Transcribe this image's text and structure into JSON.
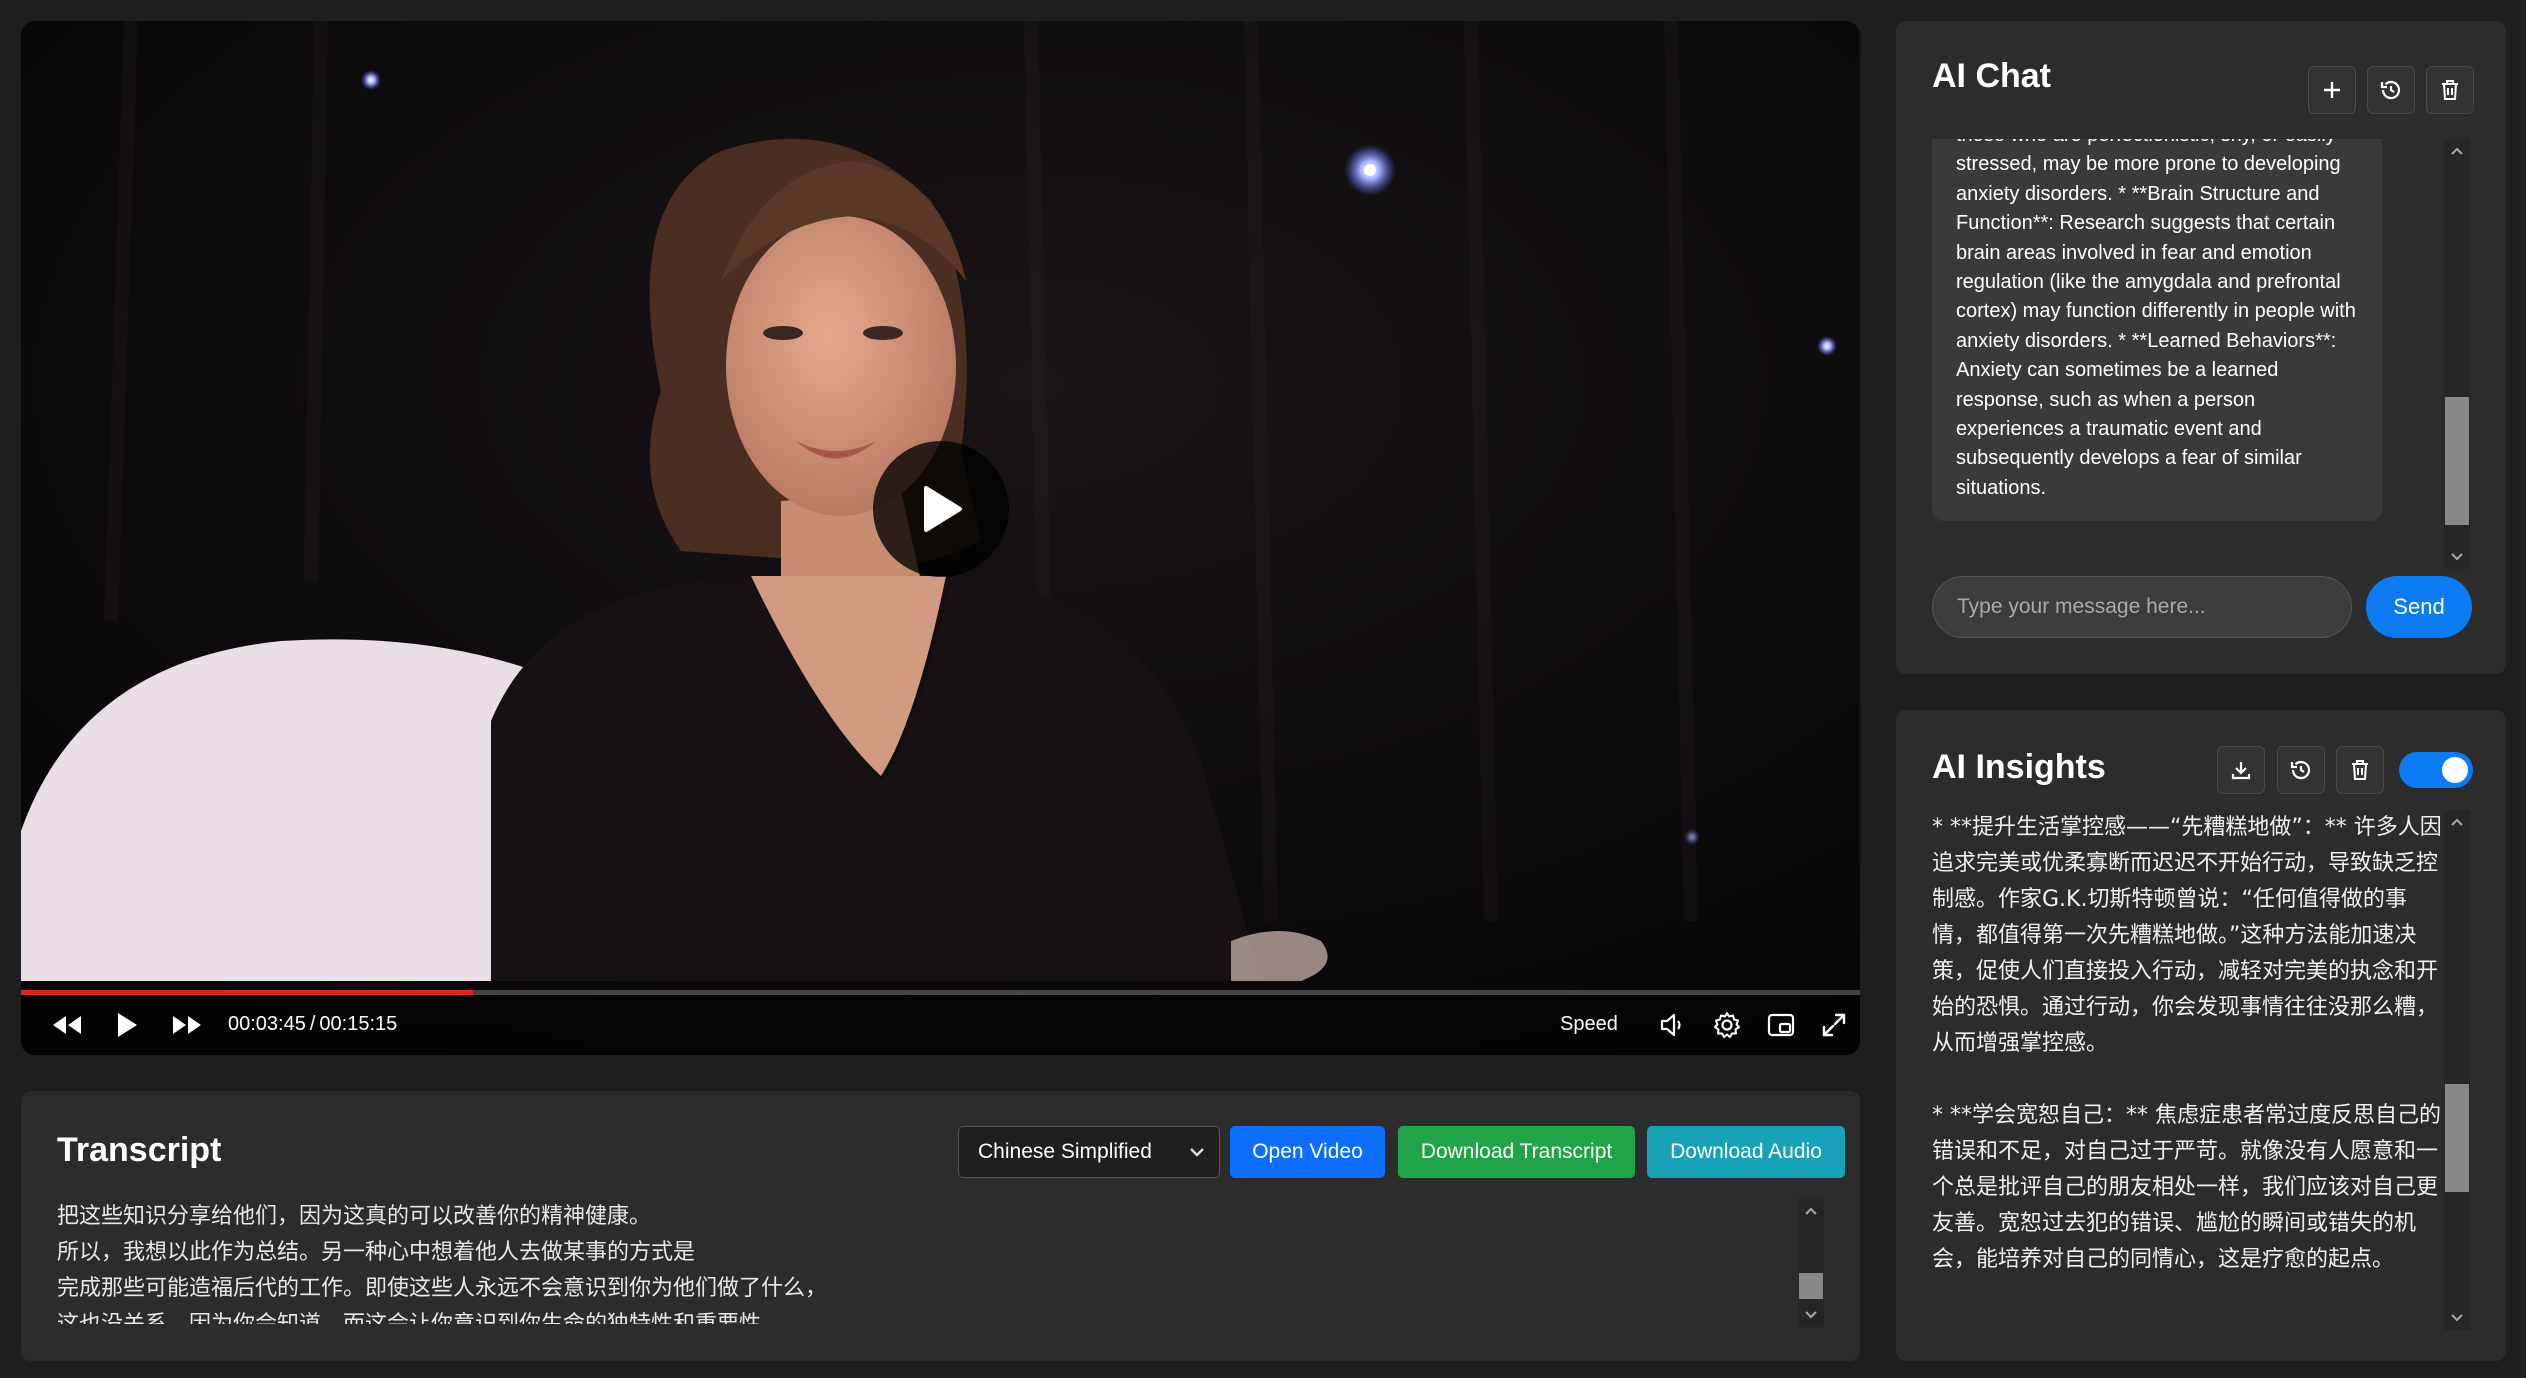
{
  "video": {
    "current_time": "00:03:45",
    "separator": "/",
    "duration": "00:15:15",
    "progress": 0.2459,
    "speed_label": "Speed",
    "progress_color": "#e0241f"
  },
  "transcript": {
    "title": "Transcript",
    "language": "Chinese Simplified",
    "open_video_label": "Open Video",
    "download_transcript_label": "Download Transcript",
    "download_audio_label": "Download Audio",
    "lines": [
      "把这些知识分享给他们，因为这真的可以改善你的精神健康。",
      "所以，我想以此作为总结。另一种心中想着他人去做某事的方式是",
      "完成那些可能造福后代的工作。即使这些人永远不会意识到你为他们做了什么，",
      "这也没关系，因为你会知道，而这会让你意识到你生命的独特性和重要性"
    ]
  },
  "chat": {
    "title": "AI Chat",
    "message": "those who are perfectionistic, shy, or easily stressed, may be more prone to developing anxiety disorders. * **Brain Structure and Function**: Research suggests that certain brain areas involved in fear and emotion regulation (like the amygdala and prefrontal cortex) may function differently in people with anxiety disorders. * **Learned Behaviors**: Anxiety can sometimes be a learned response, such as when a person experiences a traumatic event and subsequently develops a fear of similar situations.",
    "input_placeholder": "Type your message here...",
    "send_label": "Send"
  },
  "insights": {
    "title": "AI Insights",
    "toggle_on": true,
    "paragraphs": [
      "*  **提升生活掌控感——“先糟糕地做”：** 许多人因追求完美或优柔寡断而迟迟不开始行动，导致缺乏控制感。作家G.K.切斯特顿曾说：“任何值得做的事情，都值得第一次先糟糕地做。”这种方法能加速决策，促使人们直接投入行动，减轻对完美的执念和开始的恐惧。通过行动，你会发现事情往往没那么糟，从而增强掌控感。",
      "*  **学会宽恕自己：** 焦虑症患者常过度反思自己的错误和不足，对自己过于严苛。就像没有人愿意和一个总是批评自己的朋友相处一样，我们应该对自己更友善。宽恕过去犯的错误、尴尬的瞬间或错失的机会，能培养对自己的同情心，这是疗愈的起点。"
    ]
  },
  "colors": {
    "primary": "#0d6efd",
    "success": "#20a447",
    "info": "#17a2b8",
    "panel": "#2c2c2c",
    "page": "#1e1e1e"
  },
  "icons": [
    "rewind-icon",
    "play-icon",
    "fast-forward-icon",
    "volume-icon",
    "settings-gear-icon",
    "picture-in-picture-icon",
    "fullscreen-icon",
    "plus-icon",
    "history-icon",
    "trash-icon",
    "download-icon",
    "chevron-down-icon"
  ]
}
